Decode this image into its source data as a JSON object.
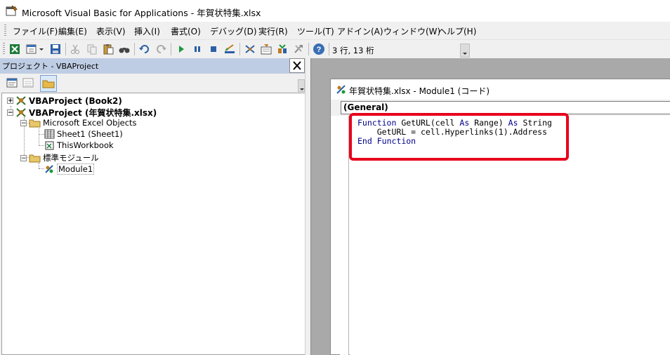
{
  "window": {
    "title": "Microsoft Visual Basic for Applications - 年賀状特集.xlsx"
  },
  "menu": {
    "items": [
      {
        "label": "ファイル(F)"
      },
      {
        "label": "編集(E)"
      },
      {
        "label": "表示(V)"
      },
      {
        "label": "挿入(I)"
      },
      {
        "label": "書式(O)"
      },
      {
        "label": "デバッグ(D)"
      },
      {
        "label": "実行(R)"
      },
      {
        "label": "ツール(T)"
      },
      {
        "label": "アドイン(A)"
      },
      {
        "label": "ウィンドウ(W)"
      },
      {
        "label": "ヘルプ(H)"
      }
    ]
  },
  "toolbar": {
    "position_readout": "3 行, 13 桁",
    "icons": [
      "excel-view-icon",
      "insert-module-icon",
      "save-icon",
      "cut-icon",
      "copy-icon",
      "paste-icon",
      "find-icon",
      "undo-icon",
      "redo-icon",
      "run-icon",
      "break-icon",
      "reset-icon",
      "design-mode-icon",
      "project-explorer-icon",
      "properties-icon",
      "object-browser-icon",
      "toolbox-icon",
      "help-icon"
    ]
  },
  "project_pane": {
    "title": "プロジェクト - VBAProject",
    "close_glyph": "✕",
    "tree": [
      {
        "label": "VBAProject (Book2)",
        "expander": "+"
      },
      {
        "label": "VBAProject (年賀状特集.xlsx)",
        "expander": "−"
      },
      {
        "label": "Microsoft Excel Objects",
        "expander": "−"
      },
      {
        "label": "Sheet1 (Sheet1)"
      },
      {
        "label": "ThisWorkbook"
      },
      {
        "label": "標準モジュール",
        "expander": "−"
      },
      {
        "label": "Module1"
      }
    ]
  },
  "code_window": {
    "title": "年賀状特集.xlsx - Module1 (コード)",
    "object_combo": "(General)",
    "lines": {
      "l1_kw1": "Function",
      "l1_mid": " GetURL(cell ",
      "l1_kw2": "As",
      "l1_mid2": " Range) ",
      "l1_kw3": "As",
      "l1_end": " String",
      "l2": "    GetURL = cell.Hyperlinks(1).Address",
      "l3_kw1": "End",
      "l3_kw2": "Function"
    }
  },
  "colors": {
    "highlight": "#e8001c",
    "keyword": "#00008b",
    "pane_header": "#bfcde4",
    "mdi_background": "#a9a9a9"
  }
}
